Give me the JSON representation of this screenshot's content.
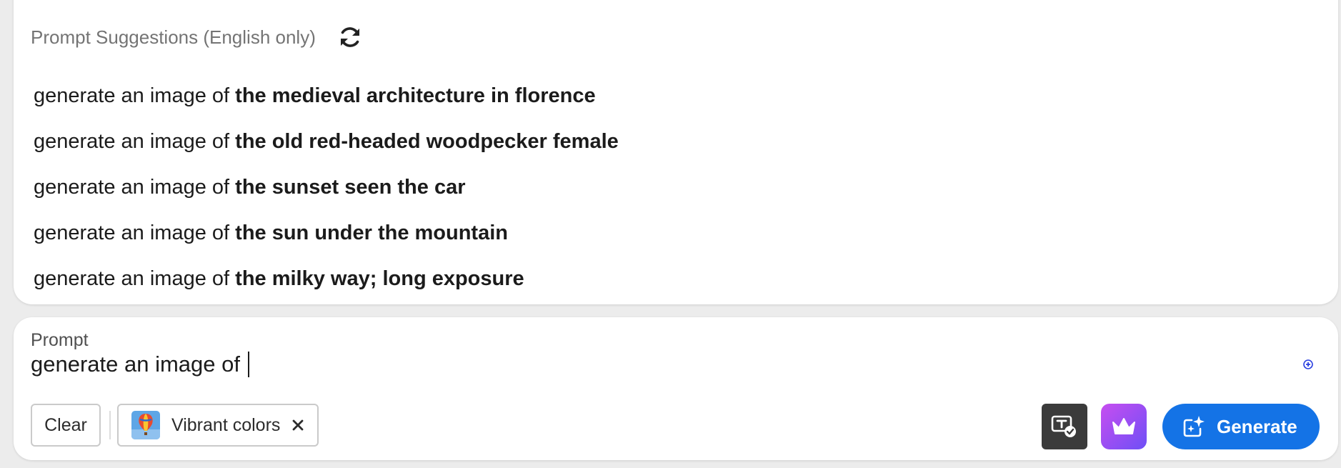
{
  "suggestions": {
    "title": "Prompt Suggestions (English only)",
    "refresh_icon": "refresh-icon",
    "items": [
      {
        "prefix": "generate an image of ",
        "subject": "the medieval architecture in florence"
      },
      {
        "prefix": "generate an image of ",
        "subject": "the old red-headed woodpecker female"
      },
      {
        "prefix": "generate an image of ",
        "subject": "the sunset seen the car"
      },
      {
        "prefix": "generate an image of ",
        "subject": "the sun under the mountain"
      },
      {
        "prefix": "generate an image of ",
        "subject": "the milky way; long exposure"
      }
    ]
  },
  "prompt": {
    "label": "Prompt",
    "value": "generate an image of "
  },
  "toolbar": {
    "clear_label": "Clear",
    "style_chip": {
      "label": "Vibrant colors",
      "thumbnail_icon": "hot-air-balloon-thumbnail",
      "remove_icon": "close-icon"
    },
    "text_credentials_icon": "text-credentials-icon",
    "premium_icon": "crown-icon",
    "generate_label": "Generate",
    "generate_icon": "generate-sparkle-icon"
  },
  "colors": {
    "accent": "#1473e6",
    "premium_gradient_start": "#c74ef0",
    "premium_gradient_end": "#6e4ff6",
    "dark_button": "#3b3b3b",
    "muted_text": "#747474"
  }
}
